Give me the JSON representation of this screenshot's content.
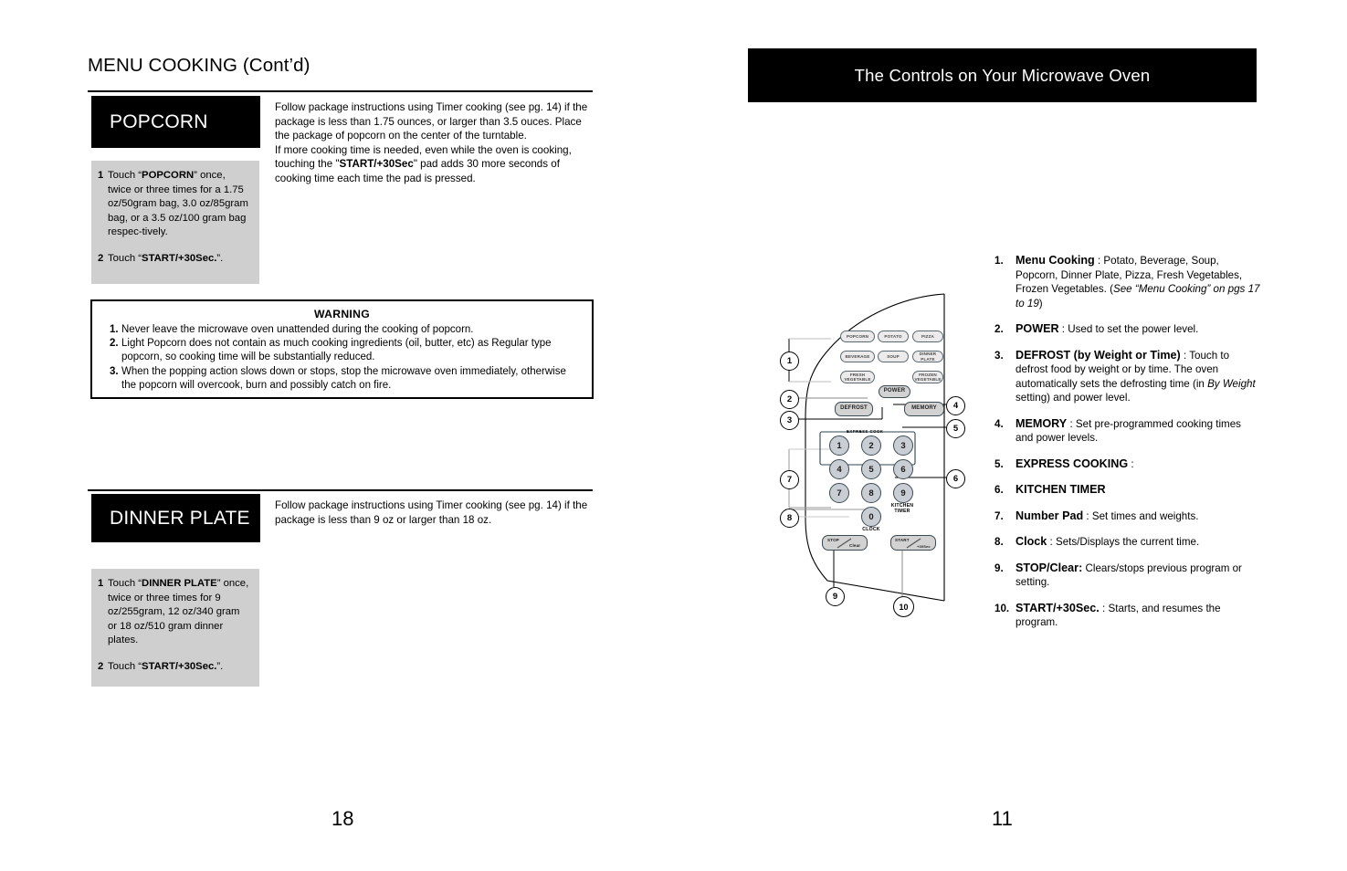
{
  "left_page": {
    "title": "MENU COOKING (Cont’d)",
    "page_number": "18",
    "popcorn": {
      "heading": "POPCORN",
      "steps": [
        {
          "num": "1",
          "text_parts": "Touch “POPCORN” once, twice or three times for a 1.75 oz/50gram bag, 3.0 oz/85gram bag, or a 3.5 oz/100 gram bag respectively."
        },
        {
          "num": "2",
          "text_parts": "Touch “START/+30Sec.”."
        }
      ],
      "body_p1": "Follow package instructions using Timer cooking (see pg. 14) if the package is less than 1.75 ounces, or larger than 3.5 ouces. Place the package of popcorn on the center of the turntable.",
      "body_p2": "If more cooking time is needed, even while the oven is cooking, touching the \"START/+30Sec\" pad adds 30 more seconds of cooking time each time the pad is pressed."
    },
    "warning": {
      "title": "WARNING",
      "items": [
        {
          "num": "1.",
          "text": "Never leave the microwave oven unattended during the cooking of popcorn."
        },
        {
          "num": "2.",
          "text": "Light Popcorn does not contain as much cooking ingredients (oil, butter, etc) as Regular type popcorn, so cooking time will be substantially reduced."
        },
        {
          "num": "3.",
          "text": "When the popping action slows down or stops, stop the microwave oven immediately, otherwise the popcorn will overcook, burn and possibly catch on fire."
        }
      ]
    },
    "dinner_plate": {
      "heading": "DINNER PLATE",
      "steps": [
        {
          "num": "1",
          "text_parts": "Touch “DINNER PLATE” once, twice or three times for 9 oz/255gram, 12 oz/340 gram or 18 oz/510 gram dinner plates."
        },
        {
          "num": "2",
          "text_parts": "Touch “START/+30Sec.”."
        }
      ],
      "body_p1": "Follow package instructions using Timer cooking (see pg. 14) if the package is less than 9 oz or larger than 18 oz."
    }
  },
  "right_page": {
    "header": "The Controls on Your Microwave Oven",
    "page_number": "11",
    "items": [
      {
        "num": "1.",
        "term": "Menu Cooking",
        "sep": " : ",
        "desc": "Potato, Beverage, Soup, Popcorn, Dinner Plate, Pizza, Fresh Vegetables, Frozen Vegetables. (",
        "italic": "See “Menu Cooking” on pgs 17 to 19",
        "tail": ")"
      },
      {
        "num": "2.",
        "term": "POWER",
        "sep": " : ",
        "desc": "Used to set the power level.",
        "italic": "",
        "tail": ""
      },
      {
        "num": "3.",
        "term": "DEFROST (by Weight or Time)",
        "sep": " : ",
        "desc": "Touch to defrost food by weight or by time. The oven automatically sets the defrosting time (in ",
        "italic": "By Weight",
        "tail": " setting) and power level."
      },
      {
        "num": "4.",
        "term": "MEMORY",
        "sep": " : ",
        "desc": "Set pre-programmed cooking times and power levels.",
        "italic": "",
        "tail": ""
      },
      {
        "num": "5.",
        "term": "EXPRESS COOKING",
        "sep": " :",
        "desc": "",
        "italic": "",
        "tail": ""
      },
      {
        "num": "6.",
        "term": "KITCHEN TIMER",
        "sep": "",
        "desc": "",
        "italic": "",
        "tail": ""
      },
      {
        "num": "7.",
        "term": "Number Pad",
        "sep": " : ",
        "desc": "Set times and weights.",
        "italic": "",
        "tail": ""
      },
      {
        "num": "8.",
        "term": "Clock",
        "sep": " : ",
        "desc": "Sets/Displays the current time.",
        "italic": "",
        "tail": ""
      },
      {
        "num": "9.",
        "term": "STOP/Clear:",
        "sep": " ",
        "desc": "Clears/stops previous program or setting.",
        "italic": "",
        "tail": ""
      },
      {
        "num": "10.",
        "term": "START/+30Sec.",
        "sep": " : ",
        "desc": "Starts, and resumes the program.",
        "italic": "",
        "tail": ""
      }
    ],
    "control_panel": {
      "menu_buttons": [
        {
          "id": "popcorn",
          "label": "POPCORN"
        },
        {
          "id": "potato",
          "label": "POTATO"
        },
        {
          "id": "pizza",
          "label": "PIZZA"
        },
        {
          "id": "beverage",
          "label": "BEVERAGE"
        },
        {
          "id": "soup",
          "label": "SOUP"
        },
        {
          "id": "dinner-plate",
          "label": "DINNER PLATE"
        },
        {
          "id": "fresh-vegetable",
          "label": "FRESH VEGETABLE"
        },
        {
          "id": "frozen-vegetable",
          "label": "FROZEN VEGETABLE"
        }
      ],
      "power_label": "POWER",
      "defrost_label": "DEFROST",
      "memory_label": "MEMORY",
      "express_cook_label": "EXPRESS COOK",
      "keys": [
        "1",
        "2",
        "3",
        "4",
        "5",
        "6",
        "7",
        "8",
        "9",
        "0"
      ],
      "kitchen_timer_label": "KITCHEN TIMER",
      "clock_label": "CLOCK",
      "stop_label": "STOP",
      "clear_label": "Clear",
      "start_label": "START",
      "plus30_label": "+30Sec",
      "callouts": [
        "1",
        "2",
        "3",
        "4",
        "5",
        "6",
        "7",
        "8",
        "9",
        "10"
      ]
    }
  }
}
